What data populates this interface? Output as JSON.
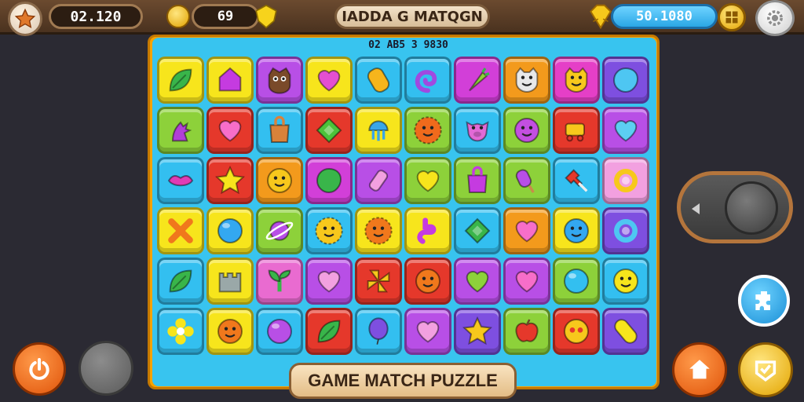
{
  "header": {
    "score": "02.120",
    "coins": "69",
    "title": "IADDA G MATQGN",
    "bank": "50.1080"
  },
  "board": {
    "header_text": "02 AB5 3 9830",
    "banner": "GAME MATCH PUZZLE",
    "rows": [
      [
        {
          "bg": "#f7e51c",
          "icon": "leaf-icon",
          "color": "#39b54a"
        },
        {
          "bg": "#f7e51c",
          "icon": "house-gem-icon",
          "color": "#c53be0"
        },
        {
          "bg": "#b84fe6",
          "icon": "owl-icon",
          "color": "#7a4a2a"
        },
        {
          "bg": "#f7e51c",
          "icon": "heart-icon",
          "color": "#e44fd0"
        },
        {
          "bg": "#33bff0",
          "icon": "candy-bar-icon",
          "color": "#f6b51c"
        },
        {
          "bg": "#33bff0",
          "icon": "swirl-icon",
          "color": "#a04ae0"
        },
        {
          "bg": "#d23fd8",
          "icon": "carrot-icon",
          "color": "#8fd13a"
        },
        {
          "bg": "#f39a1c",
          "icon": "cat-face-icon",
          "color": "#e8e8e8"
        },
        {
          "bg": "#e53fc7",
          "icon": "cat-face-icon",
          "color": "#f7c81c"
        },
        {
          "bg": "#7e4fe0",
          "icon": "blob-icon",
          "color": "#4ec6f2"
        }
      ],
      [
        {
          "bg": "#8dd13a",
          "icon": "dragon-icon",
          "color": "#b13fd6"
        },
        {
          "bg": "#e5382b",
          "icon": "heart-icon",
          "color": "#f76ec9"
        },
        {
          "bg": "#33bff0",
          "icon": "bag-icon",
          "color": "#d9823a"
        },
        {
          "bg": "#e5382b",
          "icon": "gem-icon",
          "color": "#4cc23a"
        },
        {
          "bg": "#f7e51c",
          "icon": "jellyfish-icon",
          "color": "#3aa6e6"
        },
        {
          "bg": "#8dd13a",
          "icon": "sun-face-icon",
          "color": "#f06a1c"
        },
        {
          "bg": "#33bff0",
          "icon": "pig-face-icon",
          "color": "#e26ad6"
        },
        {
          "bg": "#8dd13a",
          "icon": "smiley-icon",
          "color": "#c34fe0"
        },
        {
          "bg": "#e5382b",
          "icon": "cart-icon",
          "color": "#f7c81c"
        },
        {
          "bg": "#b84fe6",
          "icon": "heart-icon",
          "color": "#5ccff2"
        }
      ],
      [
        {
          "bg": "#33bff0",
          "icon": "lips-icon",
          "color": "#e03cb5"
        },
        {
          "bg": "#e5382b",
          "icon": "star-icon",
          "color": "#f7e51c"
        },
        {
          "bg": "#f39a1c",
          "icon": "smiley-icon",
          "color": "#f7c81c"
        },
        {
          "bg": "#d23fd8",
          "icon": "blob-icon",
          "color": "#39b54a"
        },
        {
          "bg": "#b84fe6",
          "icon": "bottle-icon",
          "color": "#f2a0e0"
        },
        {
          "bg": "#8dd13a",
          "icon": "heart-icon",
          "color": "#f7e51c"
        },
        {
          "bg": "#8dd13a",
          "icon": "bag-icon",
          "color": "#c53be0"
        },
        {
          "bg": "#8dd13a",
          "icon": "popsicle-icon",
          "color": "#b84fe6"
        },
        {
          "bg": "#33bff0",
          "icon": "tack-icon",
          "color": "#e5382b"
        },
        {
          "bg": "#f2a0e0",
          "icon": "ring-icon",
          "color": "#f7c81c"
        }
      ],
      [
        {
          "bg": "#f7e51c",
          "icon": "cross-icon",
          "color": "#f0781c"
        },
        {
          "bg": "#f7e51c",
          "icon": "ball-icon",
          "color": "#33a8f0"
        },
        {
          "bg": "#8dd13a",
          "icon": "planet-icon",
          "color": "#b84fe6"
        },
        {
          "bg": "#33bff0",
          "icon": "sun-face-icon",
          "color": "#f7c81c"
        },
        {
          "bg": "#f7e51c",
          "icon": "sun-face-icon",
          "color": "#f0781c"
        },
        {
          "bg": "#f7e51c",
          "icon": "snake-icon",
          "color": "#c53be0"
        },
        {
          "bg": "#33bff0",
          "icon": "gem-icon",
          "color": "#39b54a"
        },
        {
          "bg": "#f39a1c",
          "icon": "heart-icon",
          "color": "#f76ec9"
        },
        {
          "bg": "#f7e51c",
          "icon": "ball-face-icon",
          "color": "#33a8f0"
        },
        {
          "bg": "#7e4fe0",
          "icon": "ring-icon",
          "color": "#4ec6f2"
        }
      ],
      [
        {
          "bg": "#33bff0",
          "icon": "leaf-icon",
          "color": "#39b54a"
        },
        {
          "bg": "#f7e51c",
          "icon": "castle-icon",
          "color": "#9aa8a8"
        },
        {
          "bg": "#e96bd0",
          "icon": "sprout-icon",
          "color": "#39b54a"
        },
        {
          "bg": "#b84fe6",
          "icon": "heart-icon",
          "color": "#f2a0e0"
        },
        {
          "bg": "#e5382b",
          "icon": "pinwheel-icon",
          "color": "#f7c81c"
        },
        {
          "bg": "#e5382b",
          "icon": "smiley-icon",
          "color": "#f0781c"
        },
        {
          "bg": "#b84fe6",
          "icon": "heart-icon",
          "color": "#8dd13a"
        },
        {
          "bg": "#b84fe6",
          "icon": "heart-icon",
          "color": "#f76ec9"
        },
        {
          "bg": "#8dd13a",
          "icon": "ball-icon",
          "color": "#33bff0"
        },
        {
          "bg": "#33bff0",
          "icon": "smiley-icon",
          "color": "#f7e51c"
        }
      ],
      [
        {
          "bg": "#33bff0",
          "icon": "flower-icon",
          "color": "#f7e51c"
        },
        {
          "bg": "#f7e51c",
          "icon": "smiley-icon",
          "color": "#f0781c"
        },
        {
          "bg": "#33bff0",
          "icon": "ball-icon",
          "color": "#b84fe6"
        },
        {
          "bg": "#e5382b",
          "icon": "leaf-icon",
          "color": "#39b54a"
        },
        {
          "bg": "#33bff0",
          "icon": "balloon-icon",
          "color": "#7e4fe0"
        },
        {
          "bg": "#b84fe6",
          "icon": "heart-icon",
          "color": "#f2a0e0"
        },
        {
          "bg": "#7e4fe0",
          "icon": "star-icon",
          "color": "#f7c81c"
        },
        {
          "bg": "#8dd13a",
          "icon": "apple-icon",
          "color": "#e5382b"
        },
        {
          "bg": "#e5382b",
          "icon": "face-icon",
          "color": "#f7c81c"
        },
        {
          "bg": "#7e4fe0",
          "icon": "capsule-icon",
          "color": "#f7e51c"
        }
      ]
    ]
  }
}
